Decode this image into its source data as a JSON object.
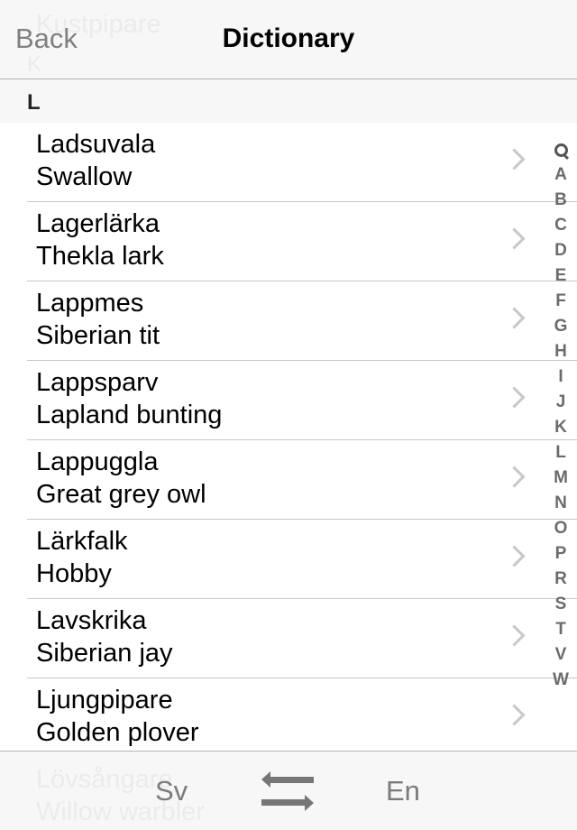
{
  "header": {
    "title": "Dictionary",
    "back_label": "Back",
    "ghost_row": "Kustpipare",
    "ghost_section": "K"
  },
  "section": {
    "letter": "L"
  },
  "rows": [
    {
      "sv": "Ladsuvala",
      "en": "Swallow"
    },
    {
      "sv": "Lagerlärka",
      "en": "Thekla lark"
    },
    {
      "sv": "Lappmes",
      "en": "Siberian tit"
    },
    {
      "sv": "Lappsparv",
      "en": "Lapland bunting"
    },
    {
      "sv": "Lappuggla",
      "en": "Great grey owl"
    },
    {
      "sv": "Lärkfalk",
      "en": "Hobby"
    },
    {
      "sv": "Lavskrika",
      "en": "Siberian jay"
    },
    {
      "sv": "Ljungpipare",
      "en": "Golden plover"
    }
  ],
  "index": {
    "search_icon": "search-icon",
    "letters": [
      "A",
      "B",
      "C",
      "D",
      "E",
      "F",
      "G",
      "H",
      "I",
      "J",
      "K",
      "L",
      "M",
      "N",
      "O",
      "P",
      "R",
      "S",
      "T",
      "V",
      "W"
    ]
  },
  "footer": {
    "source_lang": "Sv",
    "target_lang": "En",
    "swap_icon": "swap-arrows-icon",
    "ghost_sv": "Lövsångare",
    "ghost_en": "Willow warbler"
  }
}
